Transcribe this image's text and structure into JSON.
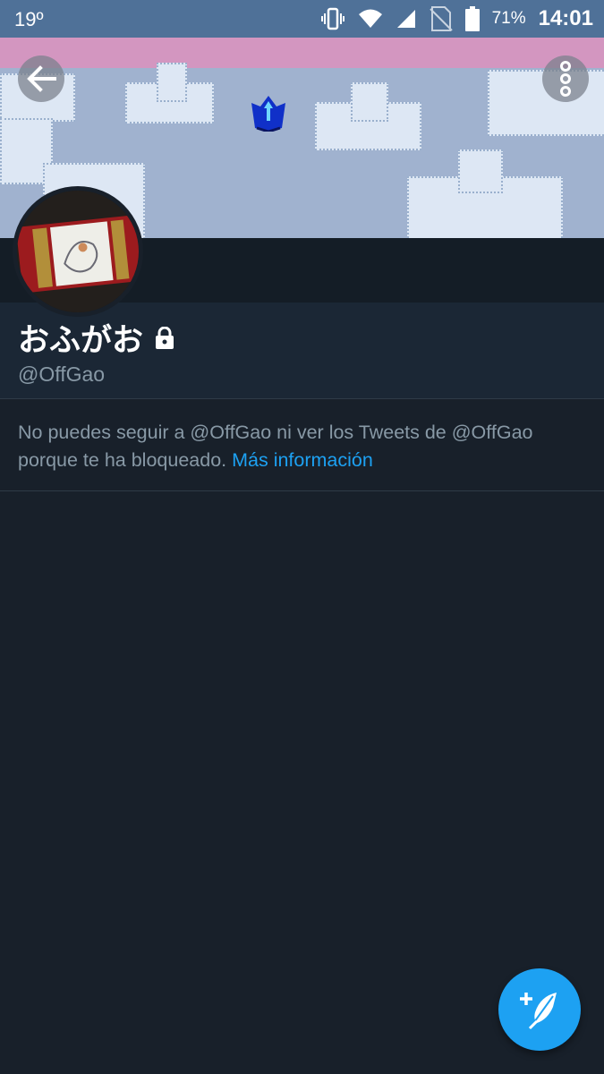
{
  "status_bar": {
    "temperature": "19º",
    "battery_percent": "71%",
    "time": "14:01"
  },
  "profile": {
    "display_name": "おふがお",
    "handle": "@OffGao",
    "locked": true
  },
  "blocked_notice": {
    "message_line1": "No puedes seguir a @OffGao ni ver los Tweets de @OffGao",
    "message_line2": "porque te ha bloqueado.",
    "link_text": "Más información"
  },
  "icons": {
    "back": "arrow-left-icon",
    "more": "more-vertical-icon",
    "lock": "lock-icon",
    "compose": "compose-tweet-icon"
  },
  "colors": {
    "accent": "#1da1f2",
    "background": "#18202a",
    "status_bar": "#4f7198"
  }
}
